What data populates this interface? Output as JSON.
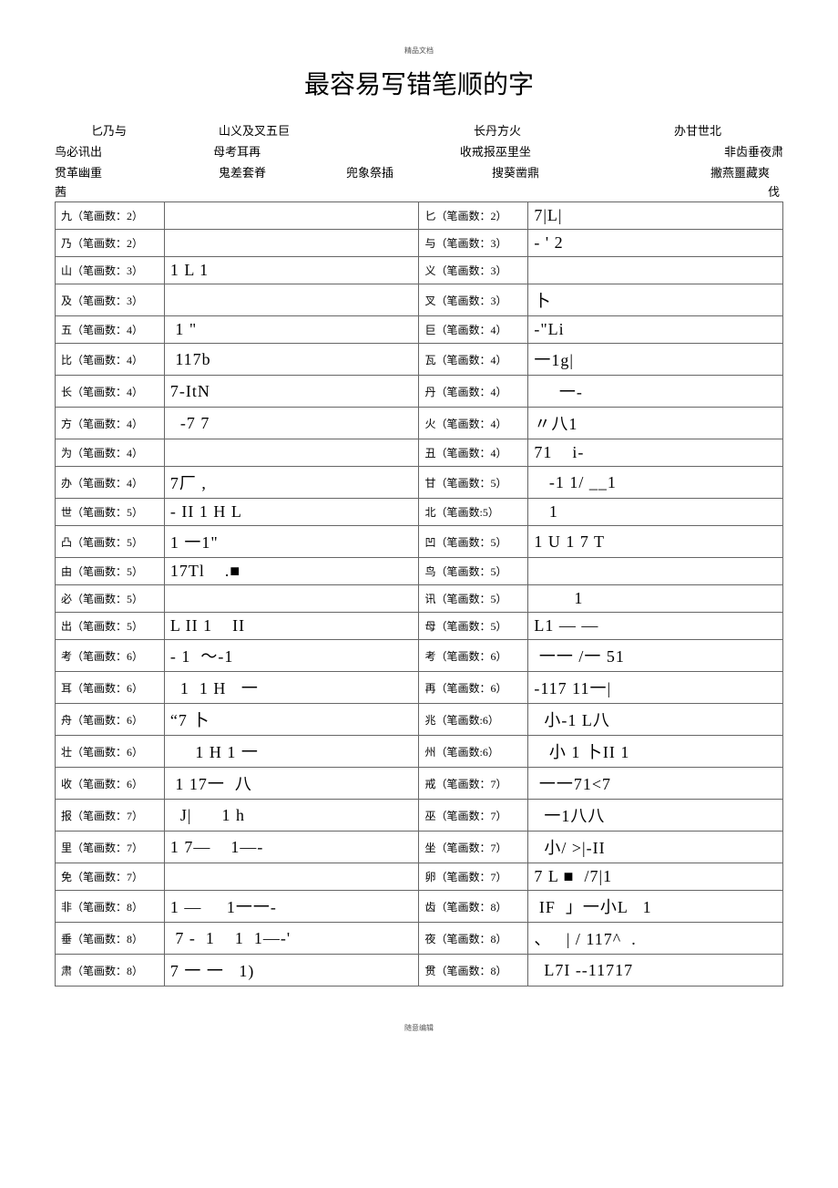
{
  "header_tiny": "精品文档",
  "title": "最容易写错笔顺的字",
  "groups": {
    "l1a": "匕乃与",
    "l1b": "山义及叉五巨",
    "l1c": "长丹方火",
    "l1d": "办甘世北",
    "l2a": "鸟必讯出",
    "l2b": "母考耳再",
    "l2c": "收戒报巫里坐",
    "l2d": "非齿垂夜肃",
    "l3a": "贯革幽重",
    "l3b": "鬼差套脊",
    "l3c": "兜象祭插",
    "l3d": "搜葵凿鼎",
    "l3e": "撇燕噩藏爽"
  },
  "orphan_left": "茜",
  "orphan_right": "伐",
  "rows": [
    {
      "l": "九（笔画数：2）",
      "ls": "",
      "r": "匕（笔画数：2）",
      "rs": "7|L|"
    },
    {
      "l": "乃（笔画数：2）",
      "ls": "",
      "r": "与（笔画数：3）",
      "rs": "- ' 2"
    },
    {
      "l": "山（笔画数：3）",
      "ls": "1 L 1",
      "r": "义（笔画数：3）",
      "rs": ""
    },
    {
      "l": "及（笔画数：3）",
      "ls": "",
      "r": "叉（笔画数：3）",
      "rs": "卜"
    },
    {
      "l": "五（笔画数：4）",
      "ls": " 1 \"",
      "r": "巨（笔画数：4）",
      "rs": "-\"Li"
    },
    {
      "l": "比（笔画数：4）",
      "ls": " 117b",
      "r": "瓦（笔画数：4）",
      "rs": "一1g|"
    },
    {
      "l": "长（笔画数：4）",
      "ls": "7-ItN",
      "r": "丹（笔画数：4）",
      "rs": "     一-"
    },
    {
      "l": "方（笔画数：4）",
      "ls": "  -7 7",
      "r": "火（笔画数：4）",
      "rs": "〃八1"
    },
    {
      "l": "为（笔画数：4）",
      "ls": "",
      "r": "丑（笔画数：4）",
      "rs": "71    i-"
    },
    {
      "l": "办（笔画数：4）",
      "ls": "7厂 ,",
      "r": "甘（笔画数：5）",
      "rs": "   -1 1/ __1"
    },
    {
      "l": "世（笔画数：5）",
      "ls": "- II 1 H L",
      "r": "北（笔画数:5）",
      "rs": "   1"
    },
    {
      "l": "凸（笔画数：5）",
      "ls": "1 一1\"",
      "r": "凹（笔画数：5）",
      "rs": "1 U 1 7 T"
    },
    {
      "l": "由（笔画数：5）",
      "ls": "17Tl    .■",
      "r": "鸟（笔画数：5）",
      "rs": ""
    },
    {
      "l": "必（笔画数：5）",
      "ls": "",
      "r": "讯（笔画数：5）",
      "rs": "        1"
    },
    {
      "l": "出（笔画数：5）",
      "ls": "L II 1    II",
      "r": "母（笔画数：5）",
      "rs": "L1 — —"
    },
    {
      "l": "考（笔画数：6）",
      "ls": "- 1  ～-1",
      "r": "考（笔画数：6）",
      "rs": " 一一 /一 51"
    },
    {
      "l": "耳（笔画数：6）",
      "ls": "  1  1 H   一",
      "r": "再（笔画数：6）",
      "rs": "-117 11一|"
    },
    {
      "l": "舟（笔画数：6）",
      "ls": "“7 卜",
      "r": "兆（笔画数:6）",
      "rs": "  小-1 L八"
    },
    {
      "l": "壮（笔画数：6）",
      "ls": "     1 H 1 一",
      "r": "州（笔画数:6）",
      "rs": "   小 1 卜II 1"
    },
    {
      "l": "收（笔画数：6）",
      "ls": " 1 17一  八",
      "r": "戒（笔画数：7）",
      "rs": " 一一71<7"
    },
    {
      "l": "报（笔画数：7）",
      "ls": "  J|      1 h",
      "r": "巫（笔画数：7）",
      "rs": "  一1八八"
    },
    {
      "l": "里（笔画数：7）",
      "ls": "1 7—    1—-",
      "r": "坐（笔画数：7）",
      "rs": "  小/ >|-II"
    },
    {
      "l": "免（笔画数：7）",
      "ls": "",
      "r": "卵（笔画数：7）",
      "rs": "7 L ■  /7|1"
    },
    {
      "l": "非（笔画数：8）",
      "ls": "1 —     1一一-",
      "r": "齿（笔画数：8）",
      "rs": " IF  」一小L   1"
    },
    {
      "l": "垂（笔画数：8）",
      "ls": " 7 -  1    1  1—-'",
      "r": "夜（笔画数：8）",
      "rs": "、   | / 117^  ."
    },
    {
      "l": "肃（笔画数：8）",
      "ls": "7 一 一   1)",
      "r": "贯（笔画数：8）",
      "rs": "  L7I --11717"
    }
  ],
  "footer_tiny": "随意编辑"
}
